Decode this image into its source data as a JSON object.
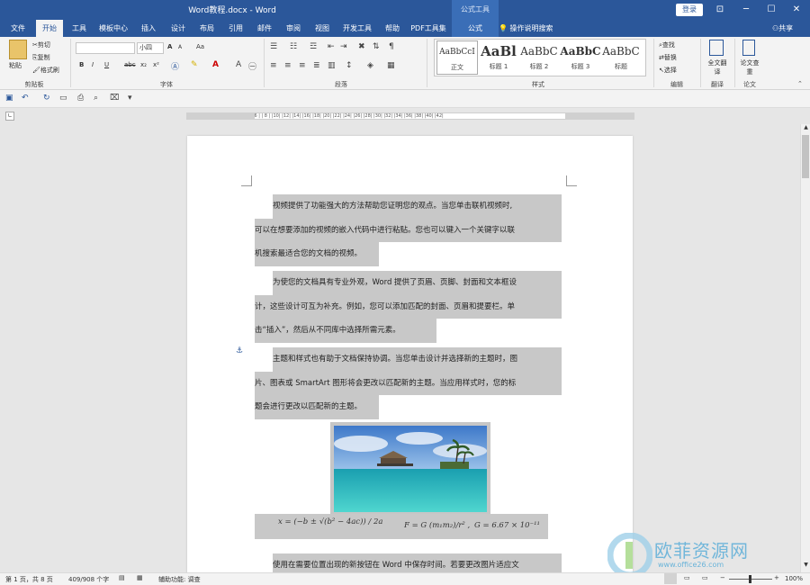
{
  "window": {
    "title": "Word教程.docx - Word",
    "context_tab_group": "公式工具",
    "login": "登录",
    "minimize": "─",
    "restore": "☐",
    "close": "✕",
    "ribbon_display": "⊡"
  },
  "tabs": [
    {
      "label": "文件"
    },
    {
      "label": "开始",
      "active": true
    },
    {
      "label": "工具"
    },
    {
      "label": "模板中心"
    },
    {
      "label": "插入"
    },
    {
      "label": "设计"
    },
    {
      "label": "布局"
    },
    {
      "label": "引用"
    },
    {
      "label": "邮件"
    },
    {
      "label": "审阅"
    },
    {
      "label": "视图"
    },
    {
      "label": "开发工具"
    },
    {
      "label": "帮助"
    },
    {
      "label": "PDF工具集"
    },
    {
      "label": "公式"
    }
  ],
  "search": {
    "icon": "lightbulb-icon",
    "label": "操作说明搜索"
  },
  "share": {
    "label": "共享",
    "icon": "person-icon"
  },
  "clipboard": {
    "paste": "粘贴",
    "cut": "剪切",
    "copy": "复制",
    "format_painter": "格式刷",
    "group": "剪贴板"
  },
  "font": {
    "family_value": "",
    "size_value": "小四",
    "group": "字体",
    "bold": "B",
    "italic": "I",
    "underline": "U",
    "strike": "abc",
    "sub": "x₂",
    "sup": "x²",
    "grow": "A",
    "shrink": "A",
    "aa": "Aa"
  },
  "paragraph": {
    "group": "段落"
  },
  "styles": {
    "group": "样式",
    "items": [
      {
        "sample": "AaBbCcI",
        "name": "正文"
      },
      {
        "sample": "AaBl",
        "name": "标题 1"
      },
      {
        "sample": "AaBbC",
        "name": "标题 2"
      },
      {
        "sample": "AaBbC",
        "name": "标题 3"
      },
      {
        "sample": "AaBbC",
        "name": "标题"
      }
    ]
  },
  "editing": {
    "find": "查找",
    "replace": "替换",
    "select": "选择",
    "group": "编辑"
  },
  "translate": {
    "label": "全文翻译",
    "group": "翻译"
  },
  "paper": {
    "label": "论文查重",
    "group": "论文"
  },
  "ruler": {
    "ticks": "| 8 | | 6 | | 4 | | 2 | | | 2 | | 4 | | 6 | | 8 | |10| |12| |14| |16| |18| |20| |22| |24| |26| |28| |30| |32| |34| |36| |38| |40| |42|"
  },
  "document": {
    "paragraphs": [
      [
        "视频提供了功能强大的方法帮助您证明您的观点。当您单击联机视频时,",
        "可以在想要添加的视频的嵌入代码中进行粘贴。您也可以键入一个关键字以联",
        "机搜索最适合您的文档的视频。"
      ],
      [
        "为使您的文档具有专业外观，Word 提供了页眉、页脚、封面和文本框设",
        "计，这些设计可互为补充。例如，您可以添加匹配的封面、页眉和提要栏。单",
        "击“插入”，然后从不同库中选择所需元素。"
      ],
      [
        "主题和样式也有助于文档保持协调。当您单击设计并选择新的主题时，图",
        "片、图表或 SmartArt 图形将会更改以匹配新的主题。当应用样式时，您的标",
        "题会进行更改以匹配新的主题。"
      ],
      [
        "使用在需要位置出现的新按钮在 Word 中保存时间。若要更改图片适应文"
      ]
    ],
    "equations": {
      "eq1": "x = (−b ± √(b² − 4ac)) / 2a",
      "eq2": "F = G (m₁m₂)/r² ,",
      "eq3": "G = 6.67 × 10⁻¹¹"
    }
  },
  "status": {
    "page": "第 1 页，共 8 页",
    "words": "409/908 个字",
    "accessibility": "辅助功能: 调查",
    "zoom": "100%"
  },
  "watermark": {
    "brand": "欧菲资源网",
    "url": "www.office26.com"
  }
}
